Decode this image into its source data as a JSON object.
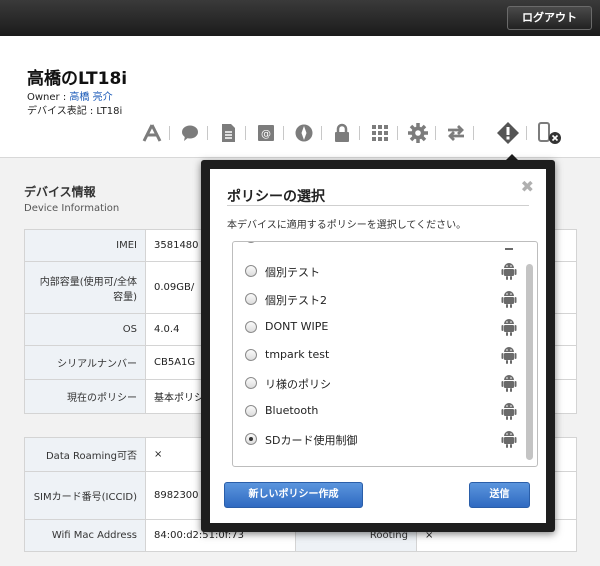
{
  "header": {
    "logout_label": "ログアウト"
  },
  "device": {
    "title": "高橋のLT18i",
    "owner_label": "Owner : ",
    "owner_name": "高橋 亮介",
    "device_label": "デバイス表記 : LT18i"
  },
  "toolbar": {
    "icons": [
      "apps-icon",
      "chat-icon",
      "document-icon",
      "mail-icon",
      "compass-icon",
      "lock-icon",
      "grid-icon",
      "gear-icon",
      "transfer-icon",
      "policy-warning-icon",
      "device-remove-icon"
    ],
    "active": "policy-warning-icon"
  },
  "device_info": {
    "title": "デバイス情報",
    "subtitle": "Device Information",
    "rows": [
      {
        "label": "IMEI",
        "value": "3581480"
      },
      {
        "label": "内部容量(使用可/全体容量)",
        "value": "0.09GB/"
      },
      {
        "label": "OS",
        "value": "4.0.4"
      },
      {
        "label": "シリアルナンバー",
        "value": "CB5A1G"
      },
      {
        "label": "現在のポリシー",
        "value": "基本ポリシ"
      }
    ]
  },
  "network_info": {
    "rows": [
      {
        "label": "Data Roaming可否",
        "value": "×"
      },
      {
        "label": "SIMカード番号(ICCID)",
        "value": "8982300"
      },
      {
        "label": "Wifi Mac Address",
        "value": "84:00:d2:51:0f:73",
        "label2": "Rooting",
        "value2": "×"
      }
    ]
  },
  "modal": {
    "title": "ポリシーの選択",
    "close_glyph": "✖",
    "description": "本デバイスに適用するポリシーを選択してください。",
    "policies": [
      {
        "name": "個別テスト",
        "checked": false
      },
      {
        "name": "個別テスト2",
        "checked": false
      },
      {
        "name": "DONT WIPE",
        "checked": false
      },
      {
        "name": "tmpark test",
        "checked": false
      },
      {
        "name": "リ様のポリシ",
        "checked": false
      },
      {
        "name": "Bluetooth",
        "checked": false
      },
      {
        "name": "SDカード使用制御",
        "checked": true
      }
    ],
    "new_policy_label": "新しいポリシー作成",
    "send_label": "送信"
  },
  "colors": {
    "accent": "#2f6ac1",
    "topbar": "#1b1b1b",
    "label_bg": "#eef2f6"
  }
}
